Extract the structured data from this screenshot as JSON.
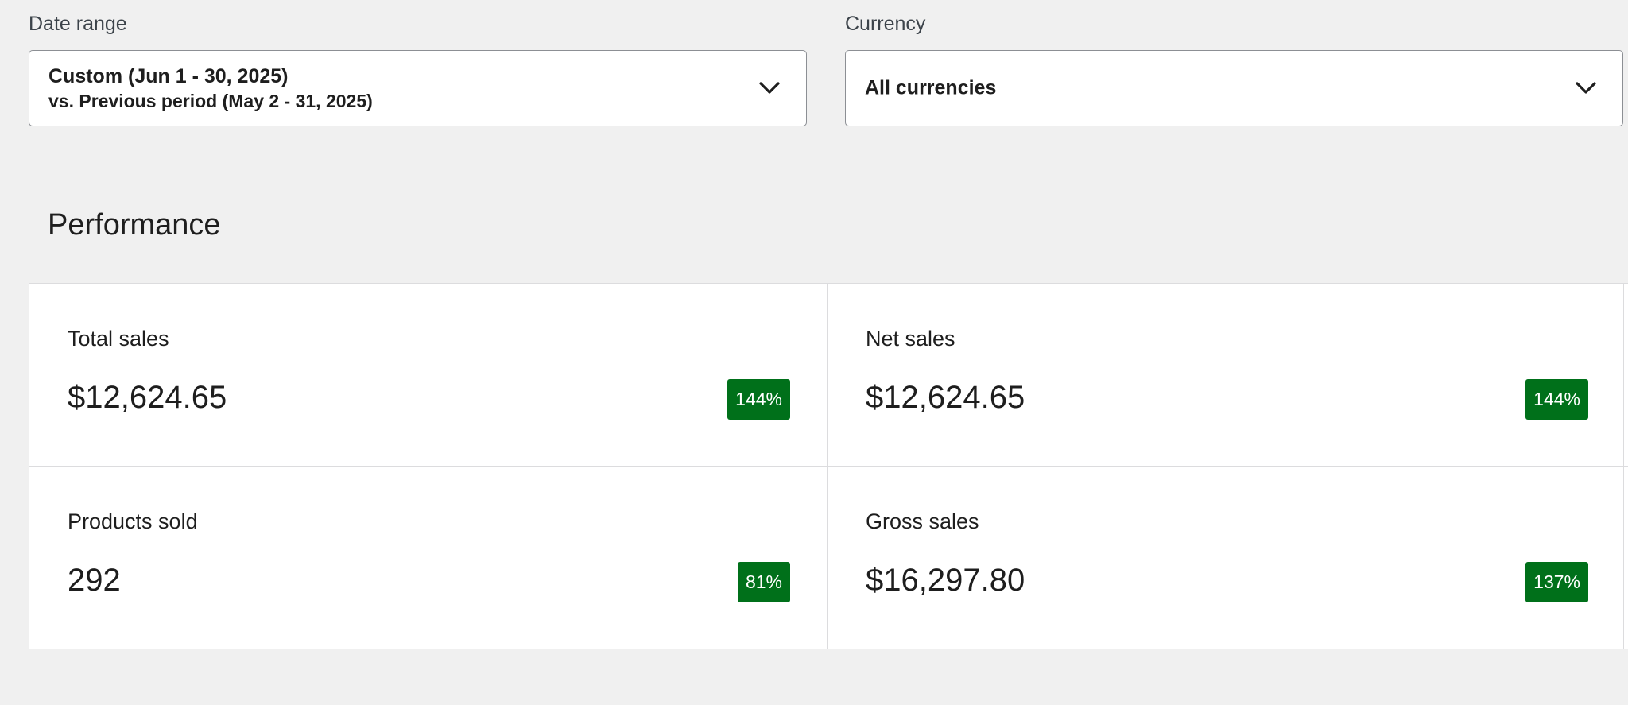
{
  "filters": {
    "date_range": {
      "label": "Date range",
      "line1": "Custom (Jun 1 - 30, 2025)",
      "line2": "vs. Previous period (May 2 - 31, 2025)",
      "icon": "chevron-down-icon"
    },
    "currency": {
      "label": "Currency",
      "value": "All currencies",
      "icon": "chevron-down-icon"
    }
  },
  "performance": {
    "title": "Performance",
    "badge_color": "#00701a",
    "cards": [
      {
        "label": "Total sales",
        "value": "$12,624.65",
        "delta": "144%"
      },
      {
        "label": "Net sales",
        "value": "$12,624.65",
        "delta": "144%"
      },
      {
        "label": "Products sold",
        "value": "292",
        "delta": "81%"
      },
      {
        "label": "Gross sales",
        "value": "$16,297.80",
        "delta": "137%"
      }
    ]
  }
}
